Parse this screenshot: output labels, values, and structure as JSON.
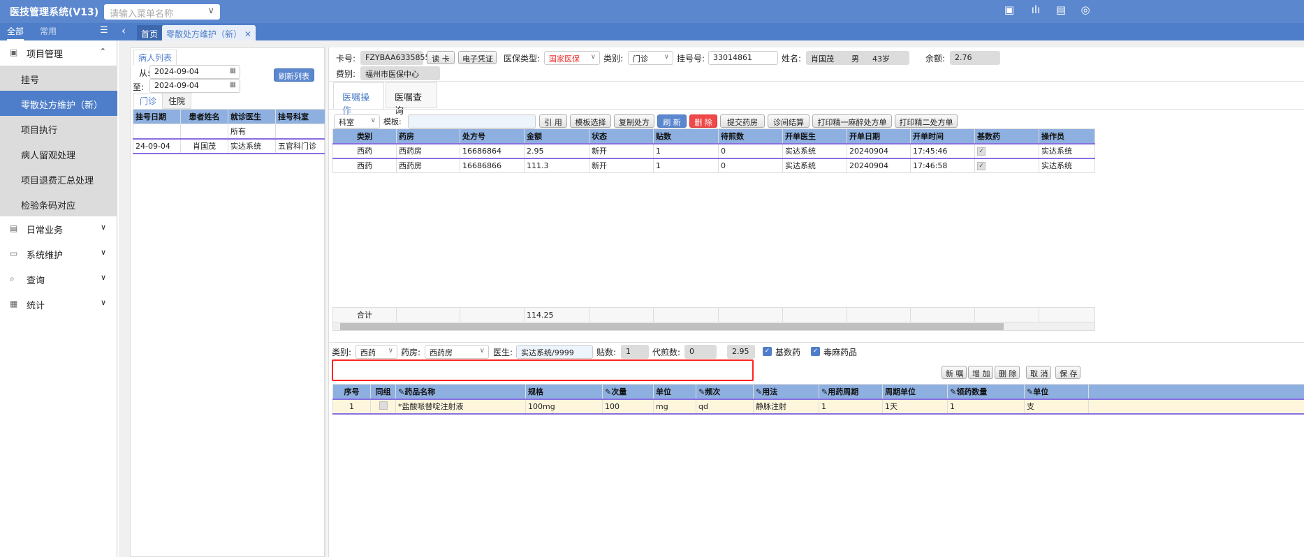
{
  "app": {
    "title": "医技管理系统(V13)",
    "menu_search_placeholder": "请输入菜单名称",
    "header_icons": [
      "si-monitor-icon",
      "chart-edit-icon",
      "receipt-icon",
      "si-circle-icon"
    ]
  },
  "sidebar": {
    "tabs": [
      "全部",
      "常用"
    ],
    "groups": [
      {
        "label": "项目管理",
        "icon": "folder-icon",
        "expanded": true,
        "items": [
          "挂号",
          "零散处方维护（新）",
          "项目执行",
          "病人留观处理",
          "项目退费汇总处理",
          "检验条码对应"
        ],
        "active": 1
      },
      {
        "label": "日常业务",
        "icon": "doc-icon"
      },
      {
        "label": "系统维护",
        "icon": "monitor-icon"
      },
      {
        "label": "查询",
        "icon": "search-icon"
      },
      {
        "label": "统计",
        "icon": "chart-icon"
      }
    ]
  },
  "tabs": {
    "home": "首页",
    "current": "零散处方维护（新）"
  },
  "patient_list": {
    "title": "病人列表",
    "from_label": "从:",
    "from": "2024-09-04",
    "to_label": "至:",
    "to": "2024-09-04",
    "refresh": "刷新列表",
    "subtabs": [
      "门诊",
      "住院"
    ],
    "columns": [
      "挂号日期",
      "患者姓名",
      "就诊医生",
      "挂号科室"
    ],
    "filter_row": [
      "",
      "",
      "所有",
      ""
    ],
    "rows": [
      [
        "24-09-04",
        "肖国茂",
        "实达系统",
        "五官科门诊"
      ]
    ]
  },
  "patient_info": {
    "card_label": "卡号:",
    "card": "FZYBAA6335855",
    "read_card": "读 卡",
    "e_voucher": "电子凭证",
    "ins_type_label": "医保类型:",
    "ins_type": "国家医保",
    "category_label": "类别:",
    "category": "门诊",
    "reg_no_label": "挂号号:",
    "reg_no": "33014861",
    "name_label": "姓名:",
    "name": "肖国茂",
    "gender": "男",
    "age": "43岁",
    "balance_label": "余额:",
    "balance": "2.76",
    "fee_label": "费别:",
    "fee": "福州市医保中心"
  },
  "main_tabs": [
    "医嘱操作",
    "医嘱查询"
  ],
  "toolbar": {
    "dept": "科室",
    "template_label": "模板:",
    "template": "",
    "buttons": [
      "引 用",
      "模板选择",
      "复制处方",
      "刷 新",
      "删 除",
      "提交药房",
      "诊间结算",
      "打印精一麻醉处方单",
      "打印精二处方单"
    ]
  },
  "rx_table": {
    "columns": [
      "类别",
      "药房",
      "处方号",
      "金额",
      "状态",
      "贴数",
      "待煎数",
      "开单医生",
      "开单日期",
      "开单时间",
      "基数药",
      "操作员"
    ],
    "rows": [
      [
        "西药",
        "西药房",
        "16686864",
        "2.95",
        "新开",
        "1",
        "0",
        "实达系统",
        "20240904",
        "17:45:46",
        "✓",
        "实达系统"
      ],
      [
        "西药",
        "西药房",
        "16686866",
        "111.3",
        "新开",
        "1",
        "0",
        "实达系统",
        "20240904",
        "17:46:58",
        "✓",
        "实达系统"
      ]
    ],
    "total_label": "合计",
    "total_amount": "114.25"
  },
  "detail_form": {
    "category_label": "类别:",
    "category": "西药",
    "pharmacy_label": "药房:",
    "pharmacy": "西药房",
    "doctor_label": "医生:",
    "doctor": "实达系统/9999",
    "doses_label": "贴数:",
    "doses": "1",
    "decoct_label": "代煎数:",
    "decoct": "0",
    "amount": "2.95",
    "base_drug": "基数药",
    "base_drug_checked": true,
    "narcotic": "毒麻药品",
    "narcotic_checked": true
  },
  "detail_buttons": [
    "新 嘱",
    "增 加",
    "删 除",
    "取 消",
    "保 存"
  ],
  "drug_table": {
    "columns": [
      "序号",
      "同组",
      "✎药品名称",
      "规格",
      "✎次量",
      "单位",
      "✎频次",
      "✎用法",
      "✎用药周期",
      "周期单位",
      "✎领药数量",
      "✎单位"
    ],
    "rows": [
      [
        "1",
        "",
        "*盐酸哌替啶注射液",
        "100mg",
        "100",
        "mg",
        "qd",
        "静脉注射",
        "1",
        "1天",
        "1",
        "支"
      ]
    ]
  },
  "colors": {
    "primary": "#5b87cf",
    "header_grid": "#8eb0e0",
    "danger": "#f04848",
    "highlight_row": "#fdf6dc"
  }
}
